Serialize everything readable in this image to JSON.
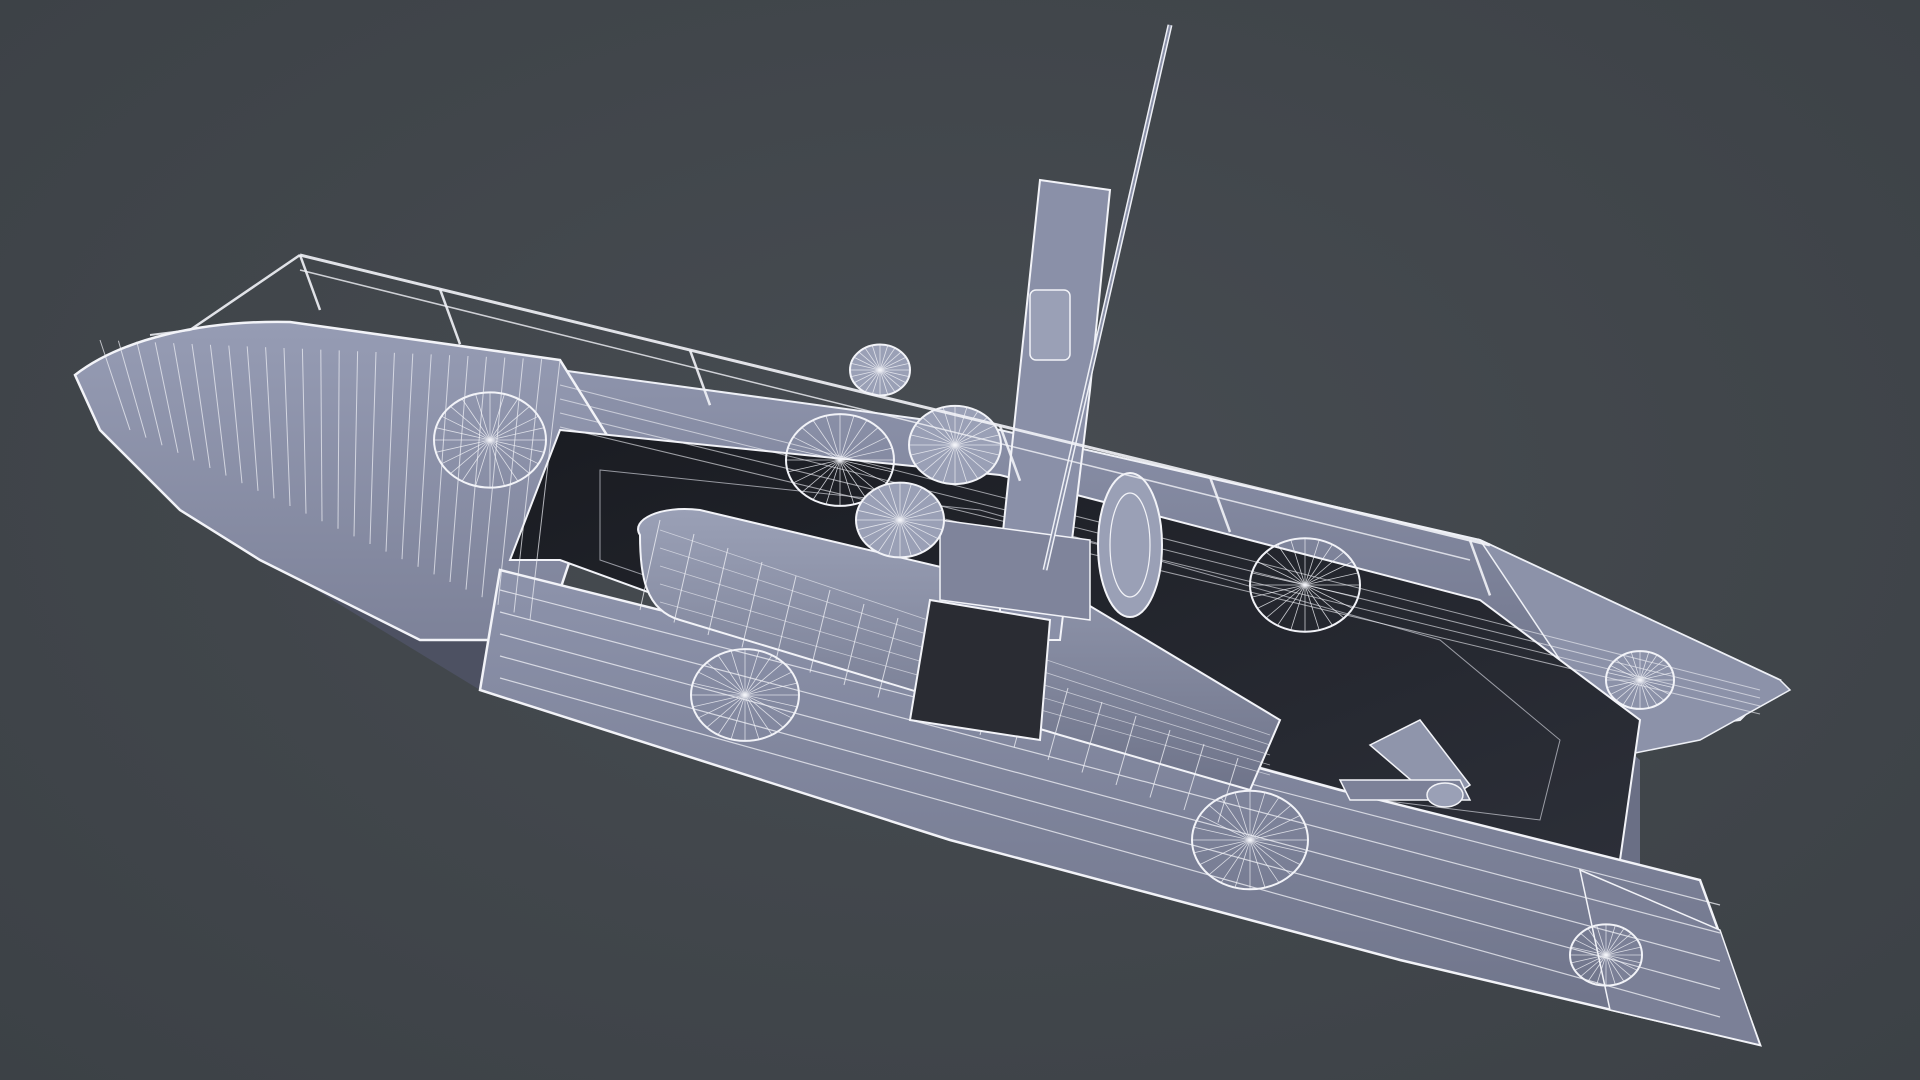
{
  "scene": {
    "background_color": "#41464b",
    "hull_color": "#8a90a8",
    "hull_shadow_color": "#5d6276",
    "interior_color": "#23252c",
    "wire_color": "#f2f3f8",
    "objects": [
      "hull",
      "port-tube",
      "starboard-tube",
      "cockpit-well",
      "torpedo-payload",
      "launcher-mast",
      "antenna",
      "guard-rails",
      "lifebuoy",
      "propeller-assembly"
    ]
  }
}
